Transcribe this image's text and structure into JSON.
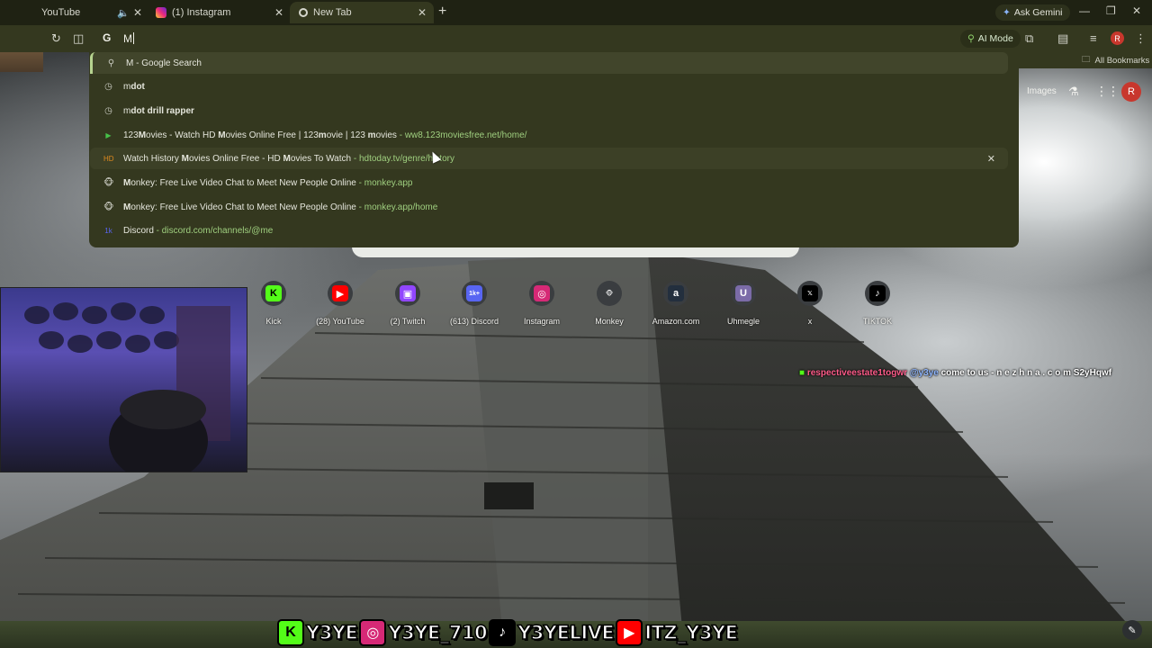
{
  "tabs": [
    {
      "title": "YouTube",
      "muted_icon": "speaker-icon",
      "active": false
    },
    {
      "title": "(1) Instagram",
      "active": false
    },
    {
      "title": "New Tab",
      "active": true
    }
  ],
  "tabstrip": {
    "ask_gemini": "Ask Gemini"
  },
  "toolbar": {
    "omnibox_text": "M",
    "ai_mode_label": "AI Mode",
    "profile_initial": "R"
  },
  "bookmarks": {
    "all_bookmarks": "All Bookmarks"
  },
  "suggestions": [
    {
      "icon": "search-icon",
      "parts": [
        {
          "t": "M",
          "b": false
        },
        {
          "t": " - Google Search",
          "b": false
        }
      ],
      "url": ""
    },
    {
      "icon": "history-icon",
      "parts": [
        {
          "t": "m",
          "b": false
        },
        {
          "t": "dot",
          "b": true
        }
      ],
      "url": ""
    },
    {
      "icon": "history-icon",
      "parts": [
        {
          "t": "m",
          "b": false
        },
        {
          "t": "dot drill rapper",
          "b": true
        }
      ],
      "url": ""
    },
    {
      "icon": "site-icon-123movies",
      "parts": [
        {
          "t": "123",
          "b": false
        },
        {
          "t": "M",
          "b": true
        },
        {
          "t": "ovies - Watch HD ",
          "b": false
        },
        {
          "t": "M",
          "b": true
        },
        {
          "t": "ovies Online Free | 123",
          "b": false
        },
        {
          "t": "m",
          "b": true
        },
        {
          "t": "ovie | 123 ",
          "b": false
        },
        {
          "t": "m",
          "b": true
        },
        {
          "t": "ovies",
          "b": false
        }
      ],
      "url": "ww8.123moviesfree.net/home/"
    },
    {
      "icon": "site-icon-hdtoday",
      "parts": [
        {
          "t": "Watch History ",
          "b": false
        },
        {
          "t": "M",
          "b": true
        },
        {
          "t": "ovies Online Free - HD ",
          "b": false
        },
        {
          "t": "M",
          "b": true
        },
        {
          "t": "ovies To Watch",
          "b": false
        }
      ],
      "url": "hdtoday.tv/genre/history"
    },
    {
      "icon": "site-icon-monkey",
      "parts": [
        {
          "t": "M",
          "b": true
        },
        {
          "t": "onkey: Free Live Video Chat to Meet New People Online",
          "b": false
        }
      ],
      "url": "monkey.app"
    },
    {
      "icon": "site-icon-monkey",
      "parts": [
        {
          "t": "M",
          "b": true
        },
        {
          "t": "onkey: Free Live Video Chat to Meet New People Online",
          "b": false
        }
      ],
      "url": "monkey.app/home"
    },
    {
      "icon": "site-icon-discord",
      "parts": [
        {
          "t": "Discord",
          "b": false
        }
      ],
      "url": "discord.com/channels/@me"
    }
  ],
  "ntp": {
    "images_link": "Images",
    "avatar_initial": "R",
    "shortcuts": [
      {
        "label": "Kick",
        "glyph": "K",
        "color": "#53fc18",
        "fg": "#000000"
      },
      {
        "label": "(28) YouTube",
        "glyph": "▶",
        "color": "#ff0000",
        "fg": "#ffffff"
      },
      {
        "label": "(2) Twitch",
        "glyph": "▣",
        "color": "#9146ff",
        "fg": "#ffffff"
      },
      {
        "label": "(613) Discord",
        "glyph": "1k+",
        "color": "#5865f2",
        "fg": "#ffffff"
      },
      {
        "label": "Instagram",
        "glyph": "◎",
        "color": "#d62976",
        "fg": "#ffffff"
      },
      {
        "label": "Monkey",
        "glyph": "🐵",
        "color": "#3a3d40",
        "fg": "#ffffff"
      },
      {
        "label": "Amazon.com",
        "glyph": "a",
        "color": "#232f3e",
        "fg": "#ffffff"
      },
      {
        "label": "Uhmegle",
        "glyph": "U",
        "color": "#7b6ba8",
        "fg": "#ffffff"
      },
      {
        "label": "x",
        "glyph": "𝕏",
        "color": "#000000",
        "fg": "#ffffff"
      },
      {
        "label": "TIKTOK",
        "glyph": "♪",
        "color": "#000000",
        "fg": "#ffffff"
      }
    ]
  },
  "stream_overlay": {
    "chat": {
      "user": "respectiveestate1togwr",
      "mention": "@y3ye",
      "message": "come to us - n e z h n a . c o m S2yHqwf"
    },
    "socials": [
      {
        "platform": "kick-icon",
        "handle": "Y3YE",
        "color": "#53fc18",
        "glyph": "K",
        "fg": "#000000"
      },
      {
        "platform": "instagram-icon",
        "handle": "Y3YE_710",
        "color": "#d62976",
        "glyph": "◎",
        "fg": "#ffffff"
      },
      {
        "platform": "tiktok-icon",
        "handle": "Y3YELIVE",
        "color": "#000000",
        "glyph": "♪",
        "fg": "#ffffff"
      },
      {
        "platform": "youtube-icon",
        "handle": "ITZ_Y3YE",
        "color": "#ff0000",
        "glyph": "▶",
        "fg": "#ffffff"
      }
    ]
  }
}
